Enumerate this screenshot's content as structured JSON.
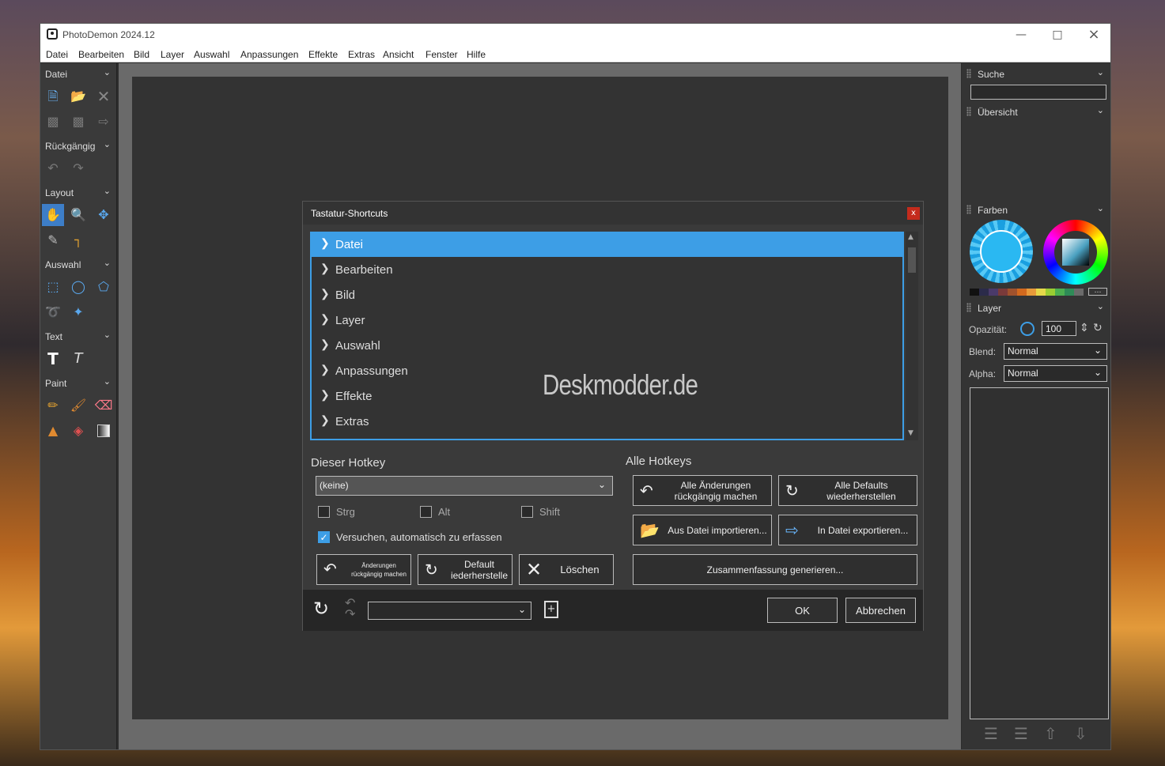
{
  "window": {
    "title": "PhotoDemon 2024.12"
  },
  "menubar": [
    "Datei",
    "Bearbeiten",
    "Bild",
    "Layer",
    "Auswahl",
    "Anpassungen",
    "Effekte",
    "Extras",
    "Ansicht",
    "Fenster",
    "Hilfe"
  ],
  "toolbox": {
    "sections": {
      "datei": "Datei",
      "undo": "Rückgängig",
      "layout": "Layout",
      "auswahl": "Auswahl",
      "text": "Text",
      "paint": "Paint"
    }
  },
  "right_panel": {
    "search_label": "Suche",
    "overview_label": "Übersicht",
    "colors_label": "Farben",
    "layer_label": "Layer",
    "opacity_label": "Opazität:",
    "opacity_value": "100",
    "blend_label": "Blend:",
    "blend_value": "Normal",
    "alpha_label": "Alpha:",
    "alpha_value": "Normal",
    "palette": [
      "#111111",
      "#2b2b4a",
      "#4a3a6a",
      "#7a3a3a",
      "#a0522d",
      "#d2691e",
      "#e89a3a",
      "#e6d84a",
      "#9acd32",
      "#4caf50",
      "#2e8b57",
      "#6b6b6b"
    ],
    "primary_color": "#2ab8f2"
  },
  "dialog": {
    "title": "Tastatur-Shortcuts",
    "close": "x",
    "tree": [
      "Datei",
      "Bearbeiten",
      "Bild",
      "Layer",
      "Auswahl",
      "Anpassungen",
      "Effekte",
      "Extras"
    ],
    "this_hotkey_title": "Dieser Hotkey",
    "hotkey_value": "(keine)",
    "mod_strg": "Strg",
    "mod_alt": "Alt",
    "mod_shift": "Shift",
    "auto_capture": "Versuchen, automatisch zu erfassen",
    "btn_undo_changes": "Änderungen rückgängig machen",
    "btn_default": "Default iederherstelle",
    "btn_delete": "Löschen",
    "all_hotkeys_title": "Alle Hotkeys",
    "btn_undo_all": "Alle Änderungen rückgängig machen",
    "btn_defaults_all": "Alle Defaults wiederherstellen",
    "btn_import": "Aus Datei importieren...",
    "btn_export": "In Datei exportieren...",
    "btn_summary": "Zusammenfassung generieren...",
    "btn_ok": "OK",
    "btn_cancel": "Abbrechen"
  },
  "watermark": "Deskmodder.de"
}
